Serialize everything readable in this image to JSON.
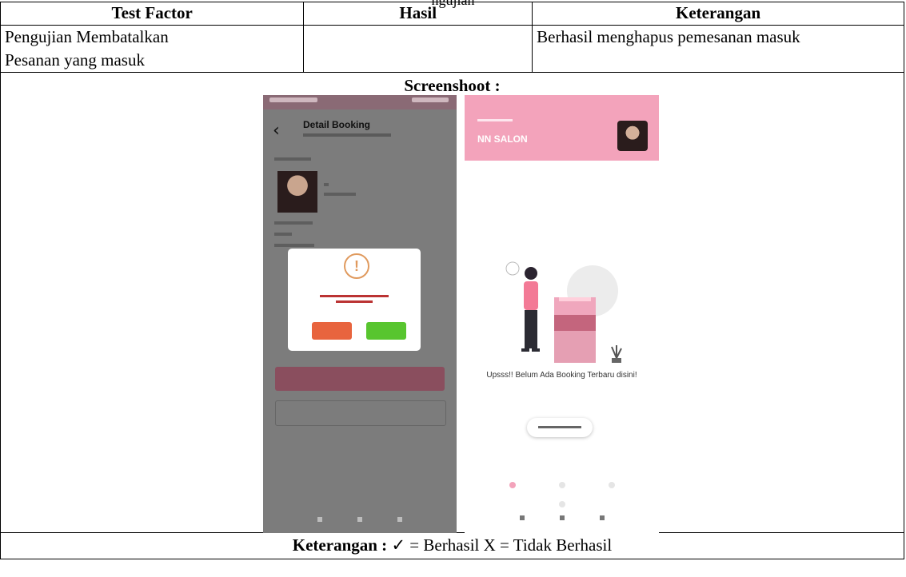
{
  "caption_fragment": "ngujian",
  "table": {
    "headers": [
      "Test Factor",
      "Hasil",
      "Keterangan"
    ],
    "row": {
      "test_factor": [
        "Pengujian Membatalkan",
        "Pesanan yang masuk"
      ],
      "hasil": "",
      "keterangan": "Berhasil menghapus pemesanan masuk"
    },
    "screenshot_label": "Screenshoot :",
    "footer": {
      "label": "Keterangan :",
      "legend": "✓ = Berhasil X = Tidak Berhasil"
    }
  },
  "phone_left": {
    "back_icon": "‹",
    "title": "Detail Booking",
    "modal": {
      "icon_text": "!"
    }
  },
  "phone_right": {
    "salon_name": "NN SALON",
    "empty_message": "Upsss!! Belum Ada Booking Terbaru disini!"
  }
}
